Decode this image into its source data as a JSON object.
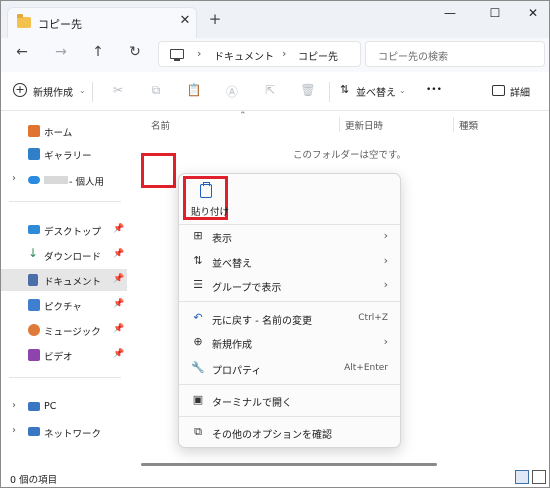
{
  "window": {
    "tab_title": "コピー先",
    "tab_close": "✕",
    "new_tab": "+",
    "minimize": "—",
    "maximize": "☐",
    "close": "✕"
  },
  "nav": {
    "back": "←",
    "forward": "→",
    "up": "↑",
    "refresh": "↻",
    "breadcrumb": [
      "ドキュメント",
      "コピー先"
    ],
    "search_placeholder": "コピー先の検索"
  },
  "commands": {
    "new_label": "新規作成",
    "sort_label": "並べ替え",
    "more": "•••",
    "details_label": "詳細"
  },
  "sidebar": {
    "items": [
      {
        "label": "ホーム",
        "color": "#e0732f"
      },
      {
        "label": "ギャラリー",
        "color": "#2f80c8"
      },
      {
        "label": "- 個人用",
        "color": "#2a8be0"
      },
      {
        "label": "デスクトップ",
        "color": "#2f8ad8"
      },
      {
        "label": "ダウンロード",
        "color": "#2e8b57"
      },
      {
        "label": "ドキュメント",
        "color": "#4a6ea9"
      },
      {
        "label": "ピクチャ",
        "color": "#3f7fcf"
      },
      {
        "label": "ミュージック",
        "color": "#e07a3a"
      },
      {
        "label": "ビデオ",
        "color": "#8e44ad"
      },
      {
        "label": "PC",
        "color": "#3a77c2"
      },
      {
        "label": "ネットワーク",
        "color": "#3a77c2"
      }
    ]
  },
  "columns": {
    "name": "名前",
    "date": "更新日時",
    "type": "種類"
  },
  "empty_message": "このフォルダーは空です。",
  "status": {
    "item_count": "0 個の項目"
  },
  "context_menu": {
    "paste_label": "貼り付け",
    "items": [
      {
        "label": "表示",
        "icon": "⊞",
        "arrow": "›"
      },
      {
        "label": "並べ替え",
        "icon": "⇅",
        "arrow": "›"
      },
      {
        "label": "グループで表示",
        "icon": "☰",
        "arrow": "›"
      },
      {
        "label": "元に戻す - 名前の変更",
        "icon": "↶",
        "accel": "Ctrl+Z"
      },
      {
        "label": "新規作成",
        "icon": "⊕",
        "arrow": "›"
      },
      {
        "label": "プロパティ",
        "icon": "🔧",
        "accel": "Alt+Enter"
      },
      {
        "label": "ターミナルで開く",
        "icon": "▣"
      },
      {
        "label": "その他のオプションを確認",
        "icon": "⧉"
      }
    ]
  },
  "colors": {
    "highlight": "#e0202a",
    "accent": "#1f5fbf"
  }
}
